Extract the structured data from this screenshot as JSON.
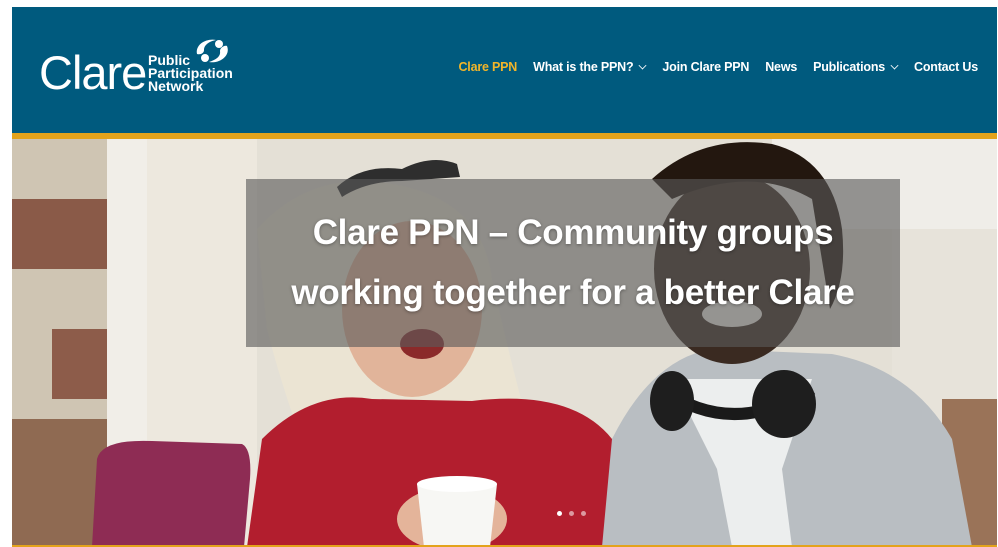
{
  "brand": {
    "logo_main": "Clare",
    "logo_line1": "Public",
    "logo_line2": "Participation",
    "logo_line3": "Network",
    "primary_color": "#005a7e",
    "accent_color": "#e3a31b",
    "active_nav_color": "#f2b52a"
  },
  "nav": {
    "items": [
      {
        "label": "Clare PPN",
        "active": true,
        "has_dropdown": false
      },
      {
        "label": "What is the PPN?",
        "active": false,
        "has_dropdown": true
      },
      {
        "label": "Join Clare PPN",
        "active": false,
        "has_dropdown": false
      },
      {
        "label": "News",
        "active": false,
        "has_dropdown": false
      },
      {
        "label": "Publications",
        "active": false,
        "has_dropdown": true
      },
      {
        "label": "Contact Us",
        "active": false,
        "has_dropdown": false
      }
    ]
  },
  "hero": {
    "title": "Clare PPN – Community groups working together for a better Clare",
    "slide_count": 3,
    "active_slide": 1
  }
}
